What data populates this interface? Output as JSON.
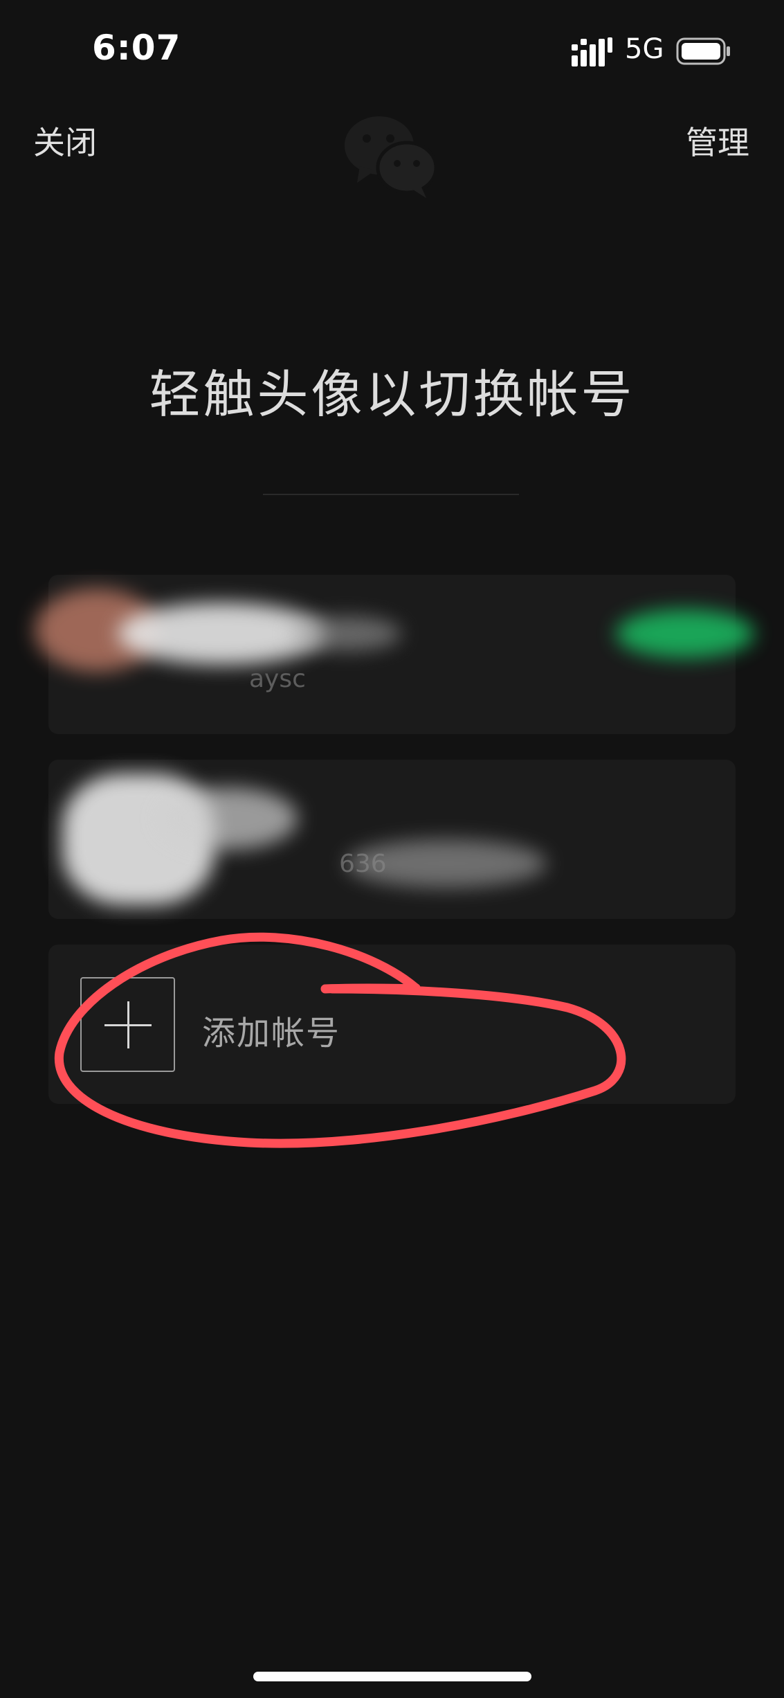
{
  "status_bar": {
    "time": "6:07",
    "network": "5G",
    "signal_icon": "signal-bars-icon",
    "battery_icon": "battery-icon"
  },
  "nav": {
    "close_label": "关闭",
    "manage_label": "管理",
    "logo_icon": "wechat-logo-icon"
  },
  "heading": "轻触头像以切换帐号",
  "accounts": [
    {
      "id_hint": "aysc",
      "status": "current",
      "status_color": "#1aad5b"
    },
    {
      "id_hint": "636"
    }
  ],
  "add_account": {
    "label": "添加帐号",
    "icon": "plus-icon"
  },
  "colors": {
    "background": "#121212",
    "card": "#1b1b1b",
    "annotation": "#ff4f57"
  }
}
